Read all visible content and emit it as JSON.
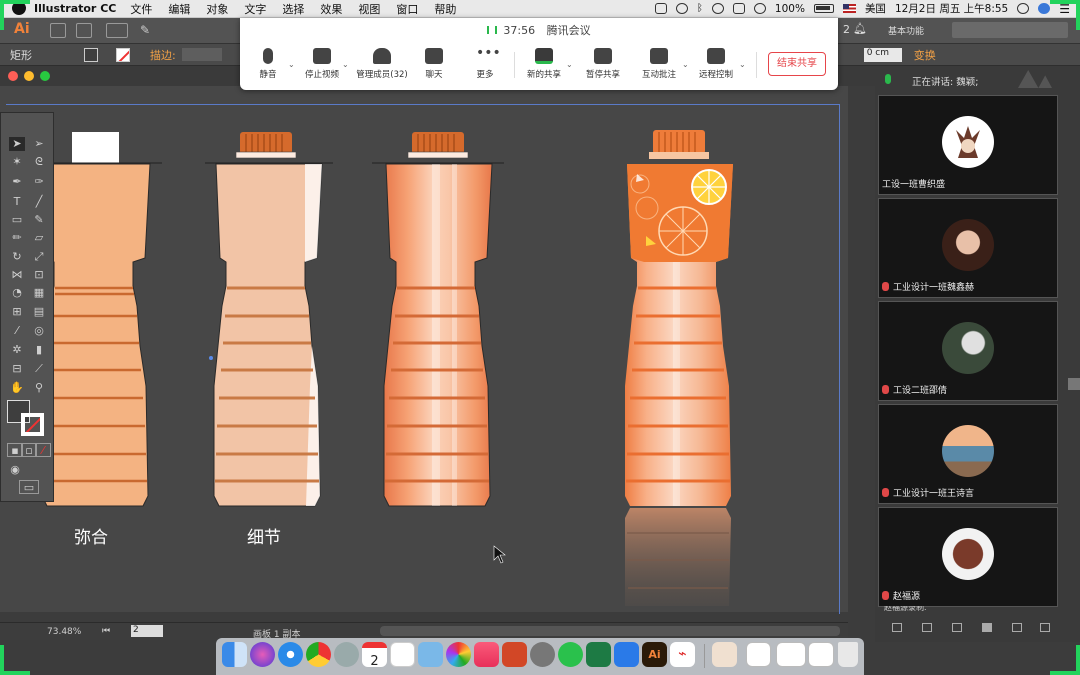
{
  "menubar": {
    "app": "Illustrator CC",
    "items": [
      "文件",
      "编辑",
      "对象",
      "文字",
      "选择",
      "效果",
      "视图",
      "窗口",
      "帮助"
    ],
    "battery": "100%",
    "input": "美国",
    "datetime": "12月2日 周五 上午8:55"
  },
  "ai": {
    "logo": "Ai",
    "workspace": "基本功能",
    "prop_label": "矩形",
    "stroke_label": "描边:",
    "measure": "0 cm",
    "transform": "变换",
    "count_hint": "2"
  },
  "meeting": {
    "timer": "37:56",
    "title": "腾讯会议",
    "buttons": [
      {
        "label": "静音"
      },
      {
        "label": "停止视频"
      },
      {
        "label": "管理成员(32)"
      },
      {
        "label": "聊天"
      },
      {
        "label": "更多"
      },
      {
        "label": "新的共享"
      },
      {
        "label": "暂停共享"
      },
      {
        "label": "互动批注"
      },
      {
        "label": "远程控制"
      }
    ],
    "end": "结束共享"
  },
  "canvas": {
    "labels": [
      "弥合",
      "细节"
    ]
  },
  "status": {
    "zoom": "73.48%",
    "page": "2",
    "artboard": "画板 1 副本"
  },
  "participants": {
    "speaking": "正在讲话: 魏颖;",
    "tiles": [
      {
        "name": "工设一班曹织盛",
        "muted": false
      },
      {
        "name": "工业设计一班魏鑫赫",
        "muted": true
      },
      {
        "name": "工设二班邵倩",
        "muted": true
      },
      {
        "name": "工业设计一班王诗言",
        "muted": true
      },
      {
        "name": "赵福源",
        "muted": true
      }
    ],
    "partial": "赵福源录制."
  },
  "dock": {
    "calendar_day": "2"
  },
  "colors": {
    "accent": "#f1823a",
    "bottle": "#f4b382",
    "bottle_light": "#f2c4a6",
    "bottle_dark": "#e8784a",
    "cap": "#d56a2c",
    "highlight": "#22d35c"
  }
}
